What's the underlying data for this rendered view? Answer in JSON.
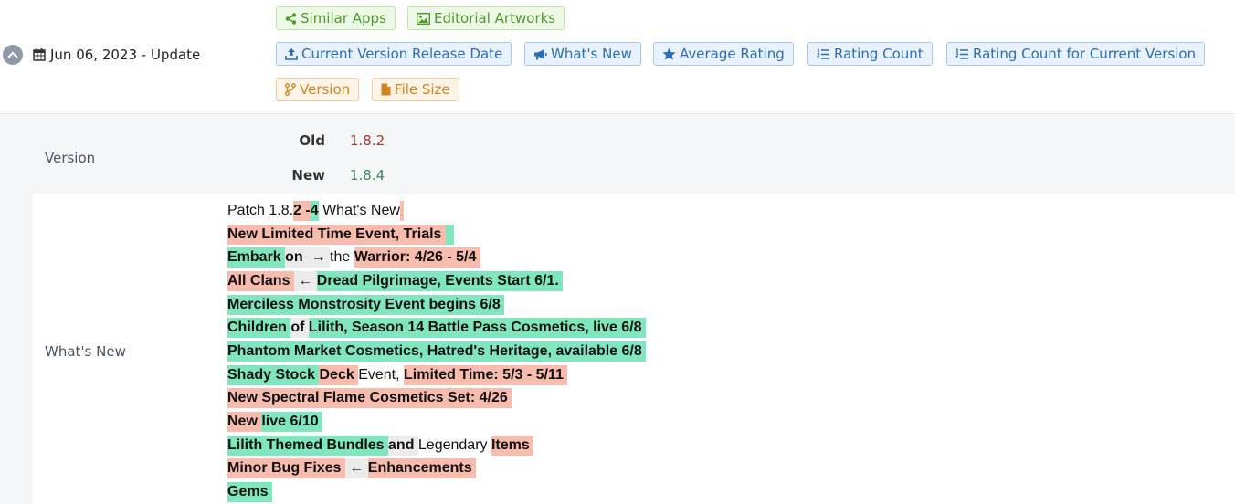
{
  "header": {
    "date_label": "Jun 06, 2023 - Update",
    "icons": {
      "collapse": "chevron-up-icon",
      "calendar": "calendar-icon"
    },
    "chips": {
      "similar_apps": "Similar Apps",
      "editorial_artworks": "Editorial Artworks",
      "release_date": "Current Version Release Date",
      "whats_new": "What's New",
      "average_rating": "Average Rating",
      "rating_count": "Rating Count",
      "rating_count_current": "Rating Count for Current Version",
      "version": "Version",
      "file_size": "File Size"
    },
    "colors": {
      "green": "#4b9a2a",
      "blue": "#2a6db8",
      "orange": "#d2851f"
    }
  },
  "version_row": {
    "label": "Version",
    "old_label": "Old",
    "old_value": "1.8.2",
    "new_label": "New",
    "new_value": "1.8.4"
  },
  "whats_new_row": {
    "label": "What's New",
    "diff_colors": {
      "removed": "#f7bcae",
      "added": "#7fe6bd",
      "unchanged": "#ebebeb"
    },
    "lines": [
      [
        {
          "t": "Patch 1.8.",
          "s": "plain"
        },
        {
          "t": "2 -",
          "s": "del"
        },
        {
          "t": "4",
          "s": "add"
        },
        {
          "t": " What's New",
          "s": "plain"
        },
        {
          "t": " ",
          "s": "del"
        }
      ],
      [
        {
          "t": "New Limited Time Event, Trials ",
          "s": "del"
        },
        {
          "t": "  ",
          "s": "add"
        }
      ],
      [
        {
          "t": "Embark ",
          "s": "add"
        },
        {
          "t": "on ",
          "s": "eq"
        },
        {
          "t": " → ",
          "s": "eq"
        },
        {
          "t": "the ",
          "s": "plain"
        },
        {
          "t": "Warrior: 4/26 - 5/4 ",
          "s": "del"
        }
      ],
      [
        {
          "t": "All Clans ",
          "s": "del"
        },
        {
          "t": " ← ",
          "s": "eq"
        },
        {
          "t": "Dread Pilgrimage, Events Start 6/1. ",
          "s": "add"
        }
      ],
      [
        {
          "t": "Merciless Monstrosity Event begins 6/8 ",
          "s": "add"
        }
      ],
      [
        {
          "t": "Children ",
          "s": "add"
        },
        {
          "t": "of ",
          "s": "eq"
        },
        {
          "t": "Lilith, Season 14 Battle Pass Cosmetics, live 6/8 ",
          "s": "add"
        }
      ],
      [
        {
          "t": "Phantom Market Cosmetics, Hatred's Heritage, available 6/8 ",
          "s": "add"
        }
      ],
      [
        {
          "t": "Shady Stock ",
          "s": "add"
        },
        {
          "t": "Deck ",
          "s": "del"
        },
        {
          "t": "Event, ",
          "s": "plain"
        },
        {
          "t": "Limited Time: 5/3 - 5/11 ",
          "s": "del"
        }
      ],
      [
        {
          "t": "New Spectral Flame Cosmetics Set: 4/26 ",
          "s": "del"
        }
      ],
      [
        {
          "t": "New ",
          "s": "del"
        },
        {
          "t": "live 6/10 ",
          "s": "add"
        }
      ],
      [
        {
          "t": "Lilith Themed Bundles ",
          "s": "add"
        },
        {
          "t": "and ",
          "s": "eq"
        },
        {
          "t": "Legendary ",
          "s": "plain"
        },
        {
          "t": "Items ",
          "s": "del"
        }
      ],
      [
        {
          "t": "Minor Bug Fixes ",
          "s": "del"
        },
        {
          "t": " ← ",
          "s": "eq"
        },
        {
          "t": "Enhancements ",
          "s": "del"
        }
      ],
      [
        {
          "t": "Gems ",
          "s": "add"
        }
      ]
    ]
  }
}
